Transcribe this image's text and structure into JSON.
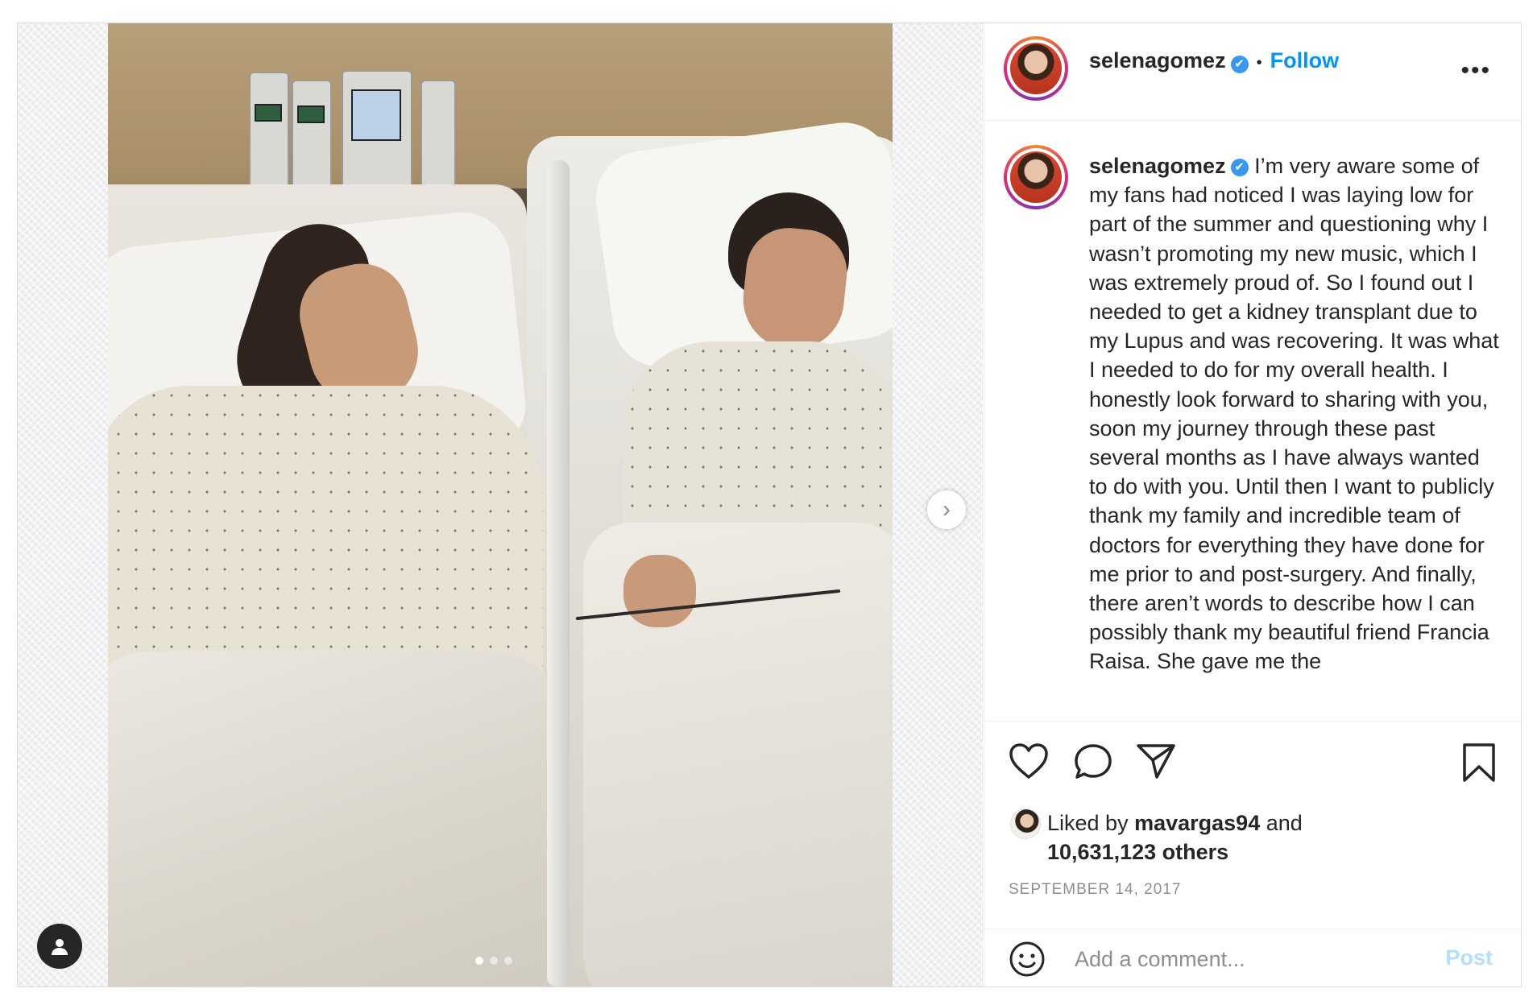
{
  "post": {
    "username": "selenagomez",
    "verified_mark": "✔",
    "separator": "•",
    "follow_label": "Follow",
    "more_label": "•••",
    "caption": "I’m very aware some of my fans had noticed I was laying low for part of the summer and questioning why I wasn’t promoting my new music, which I was extremely proud of. So I found out I needed to get a kidney transplant due to my Lupus and was recovering. It was what I needed to do for my overall health. I honestly look forward to sharing with you, soon my journey through these past several months as I have always wanted to do with you. Until then I want to publicly thank my family and incredible team of doctors for everything they have done for me prior to and post-surgery. And finally, there aren’t words to describe how I can possibly thank my beautiful friend Francia Raisa. She gave me the",
    "liked_by_prefix": "Liked by",
    "liked_by_user": "mavargas94",
    "liked_by_and": "and",
    "others_count": "10,631,123 others",
    "date": "SEPTEMBER 14, 2017",
    "comment_placeholder": "Add a comment...",
    "post_label": "Post"
  },
  "media": {
    "next_arrow": "›",
    "carousel_total": 3,
    "carousel_current": 1
  },
  "icons": {
    "like": "heart-icon",
    "comment": "comment-icon",
    "share": "share-icon",
    "save": "bookmark-icon",
    "emoji": "emoji-icon",
    "tag": "user-tag-icon"
  },
  "colors": {
    "accent": "#0095f6",
    "verified": "#3897f0",
    "text": "#262626",
    "muted": "#8e8e8e",
    "post_disabled": "#b2dffc"
  }
}
